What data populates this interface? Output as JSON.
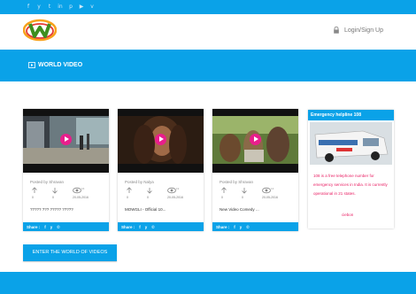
{
  "social_icons": [
    "facebook-icon",
    "twitter-icon",
    "tumblr-icon",
    "linkedin-icon",
    "pinterest-icon",
    "youtube-icon",
    "vine-icon"
  ],
  "social_glyphs": [
    "f",
    "y",
    "t",
    "in",
    "p",
    "▶",
    "v"
  ],
  "colors": {
    "primary": "#0aa2e8",
    "play": "#e91e8c",
    "helpline_text": "#e91e63"
  },
  "header": {
    "login_label": "Login/Sign Up"
  },
  "banner": {
    "title": "WORLD VIDEO"
  },
  "videos": [
    {
      "posted_by": "Posted by Shravan",
      "up": "0",
      "down": "0",
      "views": "16",
      "date": "20-05-2016",
      "title": "????? ??? ????? ?????"
    },
    {
      "posted_by": "Posted by Nalya",
      "up": "0",
      "down": "0",
      "views": "19",
      "date": "20-05-2016",
      "title": "MOWGLI - Official 10..."
    },
    {
      "posted_by": "Posted by Shravan",
      "up": "0",
      "down": "0",
      "views": "13",
      "date": "20-05-2016",
      "title": "New Video Comedy ..."
    }
  ],
  "share_label": "Share :",
  "helpline": {
    "title": "Emergency helpline 108",
    "text": "108 is a free telephone number for emergency services in India. It is currently operational in 21 states.",
    "by": "ciebon"
  },
  "enter_button": "ENTER THE WORLD OF VIDEOS"
}
